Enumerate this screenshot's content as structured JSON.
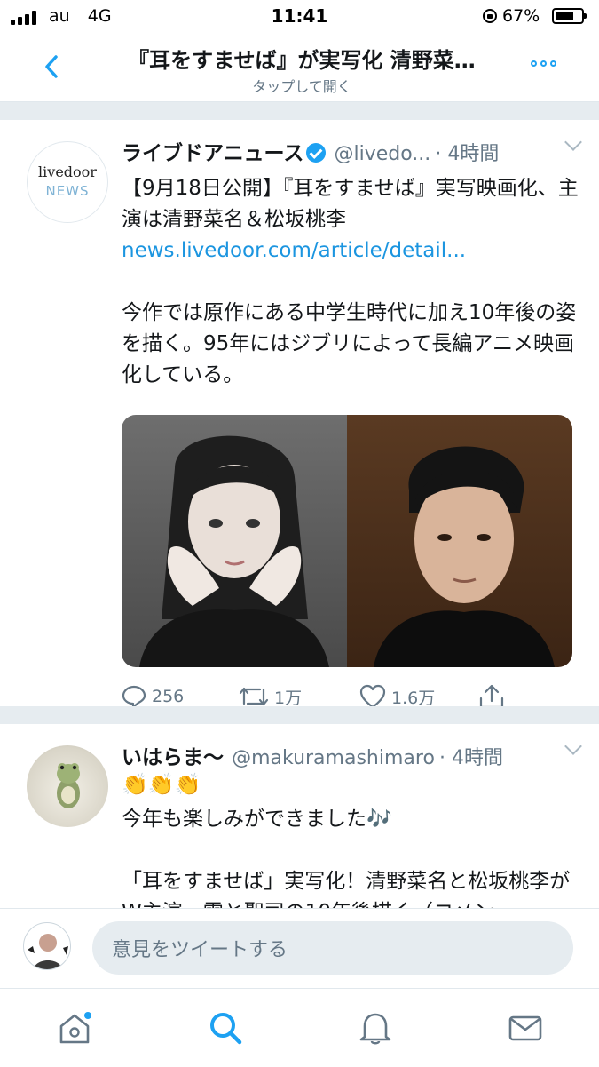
{
  "status_bar": {
    "carrier": "au",
    "network": "4G",
    "time": "11:41",
    "battery": "67%"
  },
  "nav": {
    "title": "『耳をすませば』が実写化 清野菜…",
    "subtitle": "タップして開く"
  },
  "tweets": [
    {
      "avatar_line1": "livedoor",
      "avatar_line2": "NEWS",
      "name": "ライブドアニュース",
      "handle": "@livedo...",
      "time": "· 4時間",
      "text_line1": "【9月18日公開】『耳をすませば』実写映画化、主演は清野菜名＆松坂桃李",
      "link": "news.livedoor.com/article/detail...",
      "text_line2": "今作では原作にある中学生時代に加え10年後の姿を描く。95年にはジブリによって長編アニメ映画化している。",
      "replies": "256",
      "retweets": "1万",
      "likes": "1.6万"
    },
    {
      "name": "いはらま〜",
      "handle": "@makuramashimaro",
      "time": "· 4時間",
      "emoji": "👏👏👏",
      "text_line1": "今年も楽しみができました🎶",
      "text_line2": "「耳をすませば」実写化！清野菜名と松坂桃李がW主演、雫と聖司の10年後描く（コメン"
    }
  ],
  "compose": {
    "placeholder": "意見をツイートする"
  },
  "tabs": [
    "home",
    "search",
    "notifications",
    "messages"
  ],
  "colors": {
    "accent": "#1da1f2",
    "link": "#1b95e0",
    "secondary_text": "#657786",
    "separator": "#e6ecf0"
  }
}
